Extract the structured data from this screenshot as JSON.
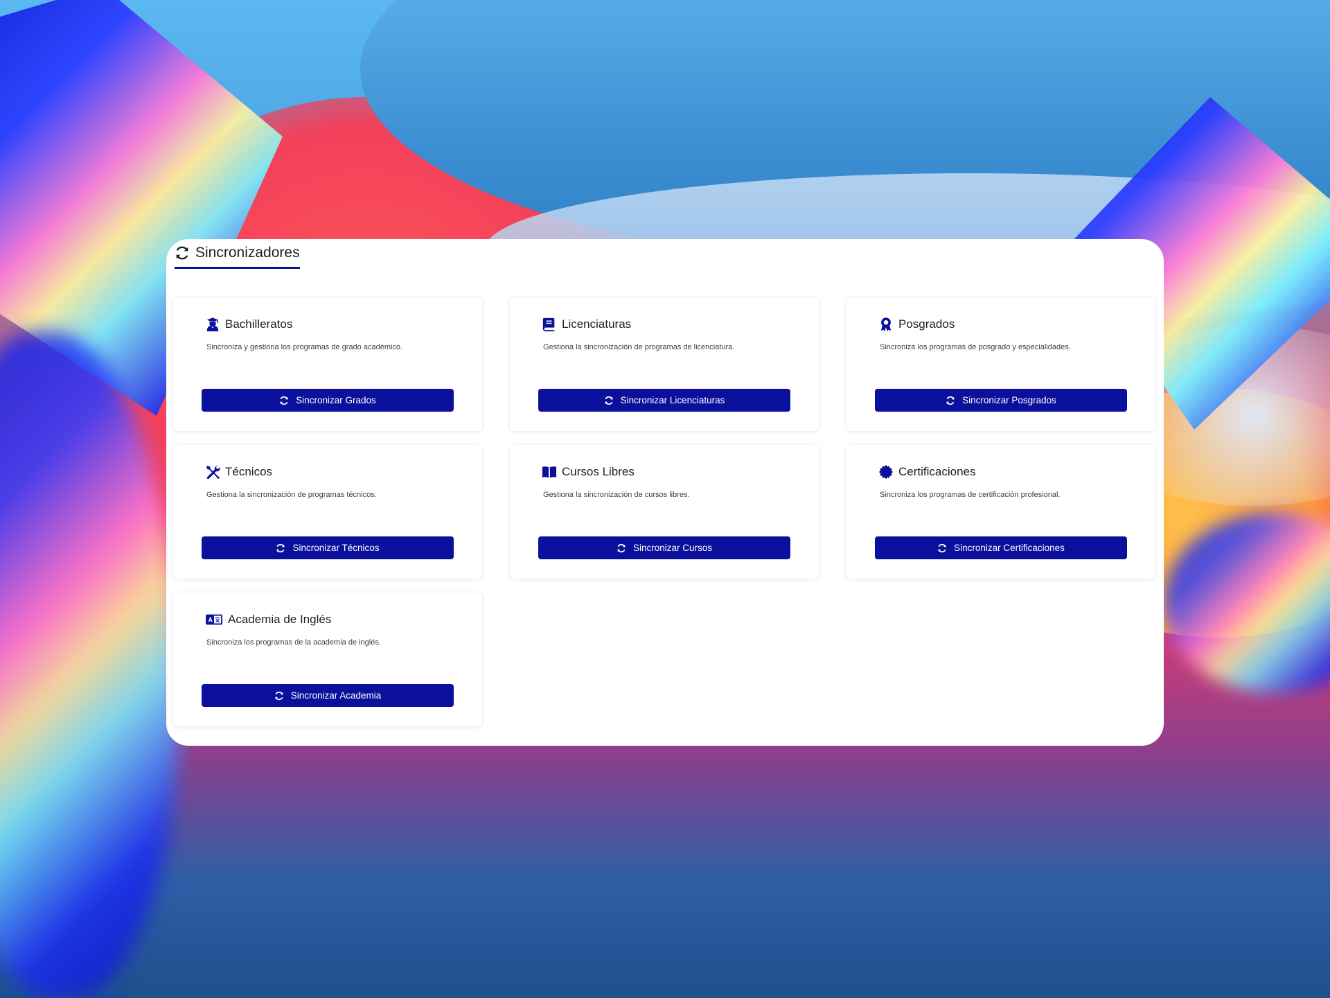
{
  "header": {
    "title": "Sincronizadores",
    "icon": "sync-icon"
  },
  "colors": {
    "accent": "#0a109c",
    "title_text": "#1b1e2b"
  },
  "cards": [
    {
      "title": "Bachilleratos",
      "icon": "graduate-icon",
      "description": "Sincroniza y gestiona los programas de grado académico.",
      "button_label": "Sincronizar Grados"
    },
    {
      "title": "Licenciaturas",
      "icon": "book-icon",
      "description": "Gestiona la sincronización de programas de licenciatura.",
      "button_label": "Sincronizar Licenciaturas"
    },
    {
      "title": "Posgrados",
      "icon": "award-icon",
      "description": "Sincroniza los programas de posgrado y especialidades.",
      "button_label": "Sincronizar Posgrados"
    },
    {
      "title": "Técnicos",
      "icon": "tools-icon",
      "description": "Gestiona la sincronización de programas técnicos.",
      "button_label": "Sincronizar Técnicos"
    },
    {
      "title": "Cursos Libres",
      "icon": "open-book-icon",
      "description": "Gestiona la sincronización de cursos libres.",
      "button_label": "Sincronizar Cursos"
    },
    {
      "title": "Certificaciones",
      "icon": "certificate-icon",
      "description": "Sincroniza los programas de certificación profesional.",
      "button_label": "Sincronizar Certificaciones"
    },
    {
      "title": "Academia de Inglés",
      "icon": "language-icon",
      "description": "Sincroniza los programas de la academia de inglés.",
      "button_label": "Sincronizar Academia"
    }
  ]
}
